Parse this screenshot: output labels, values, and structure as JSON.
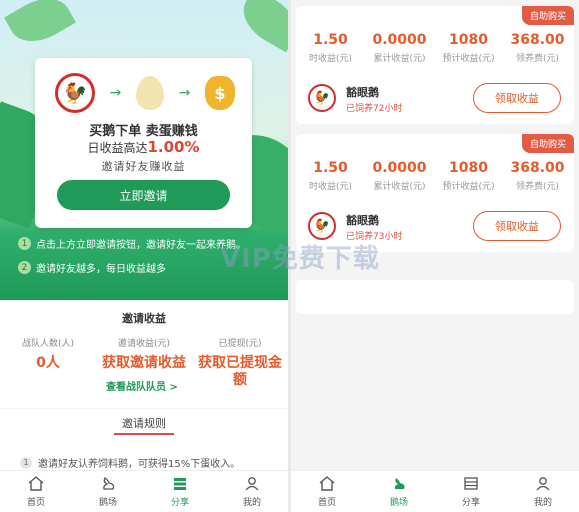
{
  "invite": {
    "flow_icons": [
      "goose-icon",
      "egg-icon",
      "money-bag-icon"
    ],
    "card_title": "买鹅下单  卖蛋赚钱",
    "rate_prefix": "日收益高达",
    "rate_value": "1.00%",
    "card_subtitle": "邀请好友赚收益",
    "invite_button": "立即邀请",
    "tips": [
      {
        "num": "1",
        "text": "点击上方立即邀请按钮，邀请好友一起来养鹅。"
      },
      {
        "num": "2",
        "text": "邀请好友越多，每日收益越多"
      }
    ]
  },
  "earnings": {
    "title": "邀请收益",
    "columns": [
      {
        "label": "战队人数(人)",
        "value": "0人"
      },
      {
        "label": "邀请收益(元)",
        "value": "获取邀请收益"
      },
      {
        "label": "已提现(元)",
        "value": "获取已提现金额"
      }
    ],
    "team_link": "查看战队队员 >"
  },
  "rules": {
    "title": "邀请规则",
    "items": [
      {
        "num": "1",
        "text": "邀请好友认养饲料鹅，可获得15%下蛋收入。"
      }
    ]
  },
  "left_tabs": [
    {
      "label": "首页",
      "icon": "home-icon",
      "active": false
    },
    {
      "label": "鹅场",
      "icon": "goose-farm-icon",
      "active": false
    },
    {
      "label": "分享",
      "icon": "share-icon",
      "active": true
    },
    {
      "label": "我的",
      "icon": "user-icon",
      "active": false
    }
  ],
  "orders": [
    {
      "badge": "自助购买",
      "stats": [
        {
          "value": "1.50",
          "label": "时收益(元)"
        },
        {
          "value": "0.0000",
          "label": "累计收益(元)"
        },
        {
          "value": "1080",
          "label": "预计收益(元)"
        },
        {
          "value": "368.00",
          "label": "领养费(元)"
        }
      ],
      "name": "豁眼鹅",
      "days": "已饲养72小时",
      "button": "领取收益"
    },
    {
      "badge": "自助购买",
      "stats": [
        {
          "value": "1.50",
          "label": "时收益(元)"
        },
        {
          "value": "0.0000",
          "label": "累计收益(元)"
        },
        {
          "value": "1080",
          "label": "预计收益(元)"
        },
        {
          "value": "368.00",
          "label": "领养费(元)"
        }
      ],
      "name": "豁眼鹅",
      "days": "已饲养73小时",
      "button": "领取收益"
    }
  ],
  "right_tabs": [
    {
      "label": "首页",
      "icon": "home-icon",
      "active": false
    },
    {
      "label": "鹅场",
      "icon": "goose-farm-icon",
      "active": true
    },
    {
      "label": "分享",
      "icon": "share-icon",
      "active": false
    },
    {
      "label": "我的",
      "icon": "user-icon",
      "active": false
    }
  ],
  "watermark": "VIP免费下载",
  "colors": {
    "brand_green": "#1f9a58",
    "accent_orange": "#e85a2a",
    "badge_red": "#e45b45"
  }
}
